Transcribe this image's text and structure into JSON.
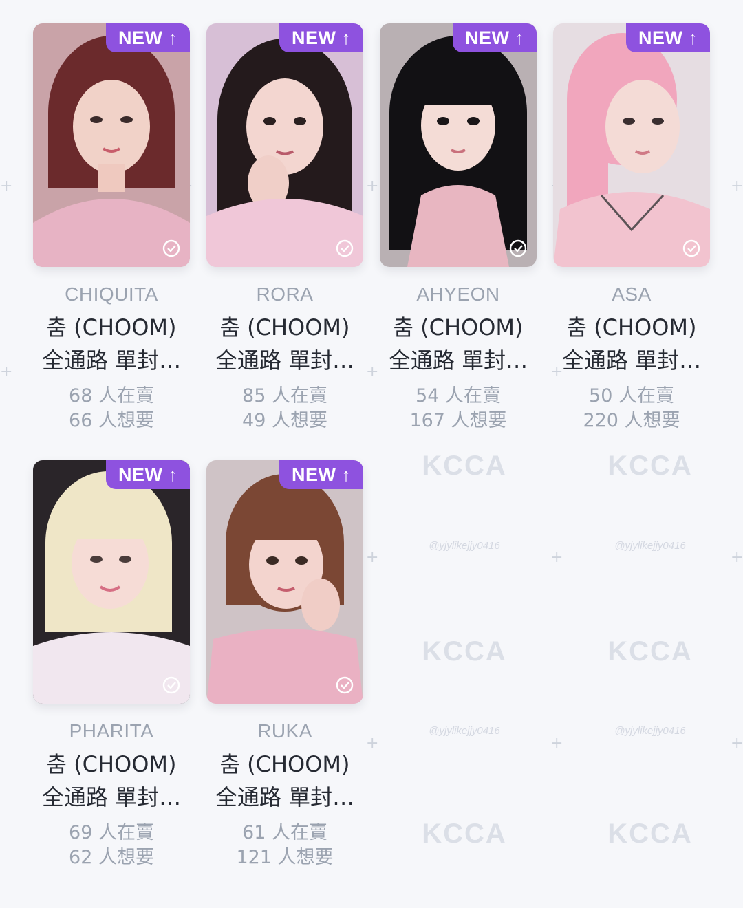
{
  "cards": [
    {
      "member": "CHIQUITA",
      "title_line1": "춤 (CHOOM)",
      "title_line2": "全通路 單封…",
      "selling": "68 人在賣",
      "wanting": "66 人想要",
      "badge": "NEW",
      "hair": "#6b2a2c",
      "bg": "#c9a3a8",
      "outfit": "#e7b3c4"
    },
    {
      "member": "RORA",
      "title_line1": "춤 (CHOOM)",
      "title_line2": "全通路 單封…",
      "selling": "85 人在賣",
      "wanting": "49 人想要",
      "badge": "NEW",
      "hair": "#241a1c",
      "bg": "#d7bfd6",
      "outfit": "#f0c7d8"
    },
    {
      "member": "AHYEON",
      "title_line1": "춤 (CHOOM)",
      "title_line2": "全通路 單封…",
      "selling": "54 人在賣",
      "wanting": "167 人想要",
      "badge": "NEW",
      "hair": "#121114",
      "bg": "#b9b0b3",
      "outfit": "#e8b6c1"
    },
    {
      "member": "ASA",
      "title_line1": "춤 (CHOOM)",
      "title_line2": "全通路 單封…",
      "selling": "50 人在賣",
      "wanting": "220 人想要",
      "badge": "NEW",
      "hair": "#f1a6bd",
      "bg": "#e6dde2",
      "outfit": "#f2c3cf"
    },
    {
      "member": "PHARITA",
      "title_line1": "춤 (CHOOM)",
      "title_line2": "全通路 單封…",
      "selling": "69 人在賣",
      "wanting": "62 人想要",
      "badge": "NEW",
      "hair": "#efe6c7",
      "bg": "#2a2529",
      "outfit": "#f1e7ef"
    },
    {
      "member": "RUKA",
      "title_line1": "춤 (CHOOM)",
      "title_line2": "全通路 單封…",
      "selling": "61 人在賣",
      "wanting": "121 人想要",
      "badge": "NEW",
      "hair": "#7b4734",
      "bg": "#cfc3c6",
      "outfit": "#eab1c3"
    }
  ],
  "watermark": {
    "logo": "KCCA",
    "handle": "@yjylikejjy0416"
  },
  "colors": {
    "badge": "#8e52df",
    "muted": "#9ba3b0",
    "text": "#262a33",
    "background": "#f6f7fa"
  }
}
